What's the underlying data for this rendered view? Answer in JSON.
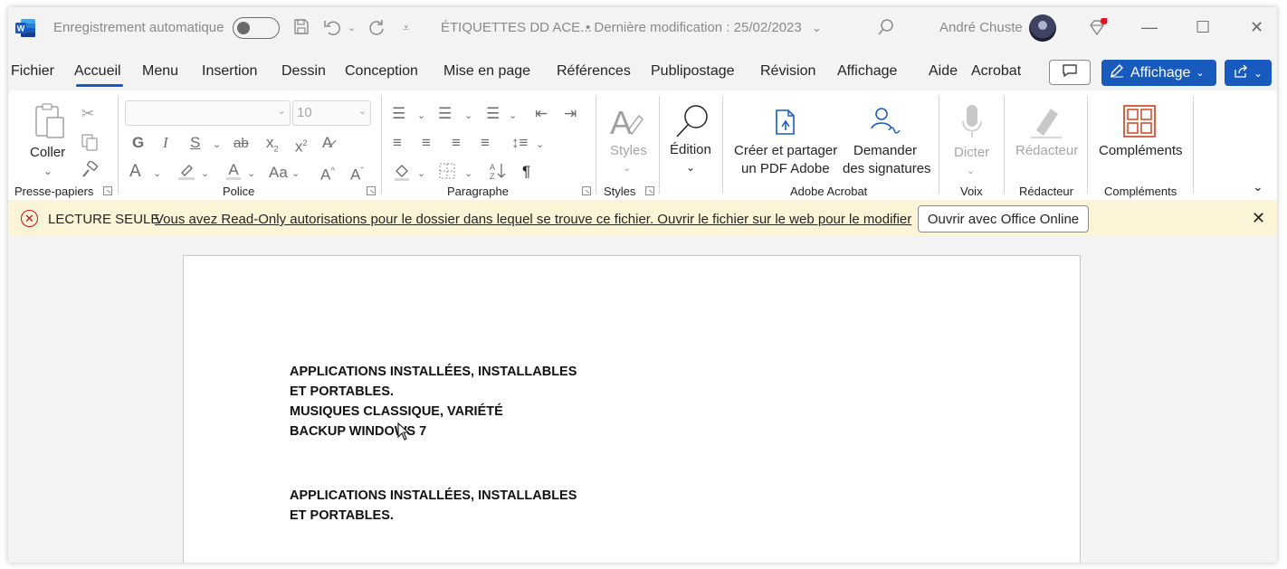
{
  "titlebar": {
    "autosave_label": "Enregistrement automatique",
    "doc_title": "ÉTIQUETTES DD ACE...",
    "last_modified": "• Dernière modification : 25/02/2023",
    "user_name": "André Chuste"
  },
  "tabs": [
    "Fichier",
    "Accueil",
    "Menu",
    "Insertion",
    "Dessin",
    "Conception",
    "Mise en page",
    "Références",
    "Publipostage",
    "Révision",
    "Affichage",
    "Aide",
    "Acrobat"
  ],
  "buttons": {
    "view_label": "Affichage"
  },
  "ribbon": {
    "clipboard": {
      "paste_label": "Coller",
      "group_label": "Presse-papiers"
    },
    "font": {
      "font_size": "10",
      "group_label": "Police"
    },
    "paragraph": {
      "group_label": "Paragraphe"
    },
    "styles": {
      "styles_label": "Styles",
      "group_label": "Styles"
    },
    "editing": {
      "label": "Édition"
    },
    "acrobat": {
      "create_pdf_line1": "Créer et partager",
      "create_pdf_line2": "un PDF Adobe",
      "request_sig_line1": "Demander",
      "request_sig_line2": "des signatures",
      "group_label": "Adobe Acrobat"
    },
    "voice": {
      "dictate_label": "Dicter",
      "group_label": "Voix"
    },
    "editor": {
      "editor_label": "Rédacteur",
      "group_label": "Rédacteur"
    },
    "addins": {
      "addins_label": "Compléments",
      "group_label": "Compléments"
    }
  },
  "infobar": {
    "title": "LECTURE SEULE",
    "message": "Vous avez Read-Only autorisations pour le dossier dans lequel se trouve ce fichier. Ouvrir le fichier sur le web pour le modifier",
    "button_label": "Ouvrir avec Office Online"
  },
  "document": {
    "lines": [
      "APPLICATIONS INSTALLÉES, INSTALLABLES",
      "ET PORTABLES.",
      "MUSIQUES CLASSIQUE, VARIÉTÉ",
      "BACKUP WINDOWS 7",
      "APPLICATIONS INSTALLÉES, INSTALLABLES",
      "ET PORTABLES."
    ]
  }
}
